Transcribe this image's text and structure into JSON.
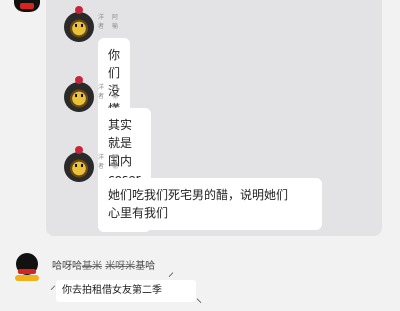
{
  "messages": [
    {
      "name1": "洋者",
      "name2": "阿榆",
      "text_lines": [
        "你们没懂"
      ]
    },
    {
      "name1": "洋者",
      "name2": "阿榆",
      "text_lines": [
        "其实就是国内coser吃醋了"
      ]
    },
    {
      "name1": "洋者",
      "name2": "阿榆",
      "text_lines": [
        "她们吃我们死宅男的醋，说明她们",
        "心里有我们"
      ]
    }
  ],
  "reply": {
    "header_prefix": "哈呀哈",
    "header_strike1": "基米",
    "header_mid": " ",
    "header_strike2": "米呀米",
    "header_suffix": "基哈",
    "text": "你去拍租借女友第二季"
  }
}
